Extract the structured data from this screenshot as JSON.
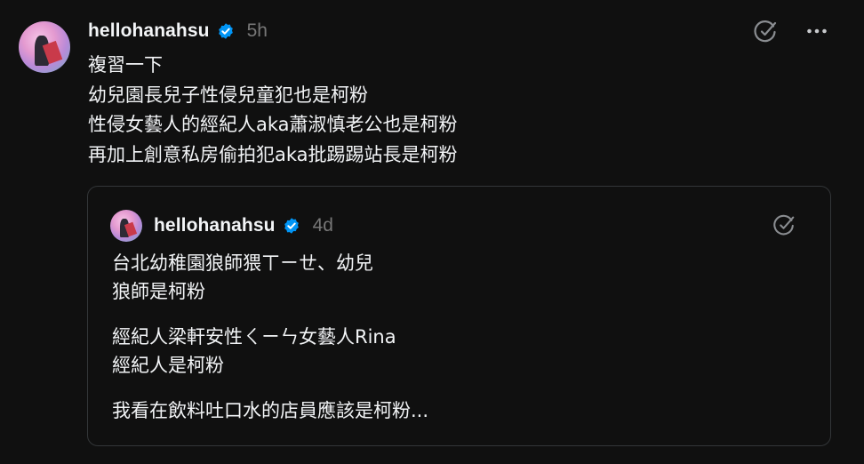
{
  "post": {
    "username": "hellohanahsu",
    "time": "5h",
    "lines": [
      "複習一下",
      "幼兒園長兒子性侵兒童犯也是柯粉",
      "性侵女藝人的經紀人aka蕭淑慎老公也是柯粉",
      "再加上創意私房偷拍犯aka批踢踢站長是柯粉"
    ],
    "icons": {
      "avatar": "profile-photo",
      "verified": "verified-badge-icon",
      "translate": "translate-icon",
      "more": "more-options-icon"
    }
  },
  "quote": {
    "username": "hellohanahsu",
    "time": "4d",
    "paragraphs": [
      [
        "台北幼稚園狼師猥ㄒㄧㄝ、幼兒",
        "狼師是柯粉"
      ],
      [
        "經紀人梁軒安性ㄑㄧㄣ女藝人Rina",
        "經紀人是柯粉"
      ],
      [
        "我看在飲料吐口水的店員應該是柯粉..."
      ]
    ]
  },
  "colors": {
    "background": "#101010",
    "text": "#f3f5f7",
    "muted": "#777777",
    "border": "#333638",
    "verified": "#0095f6"
  }
}
